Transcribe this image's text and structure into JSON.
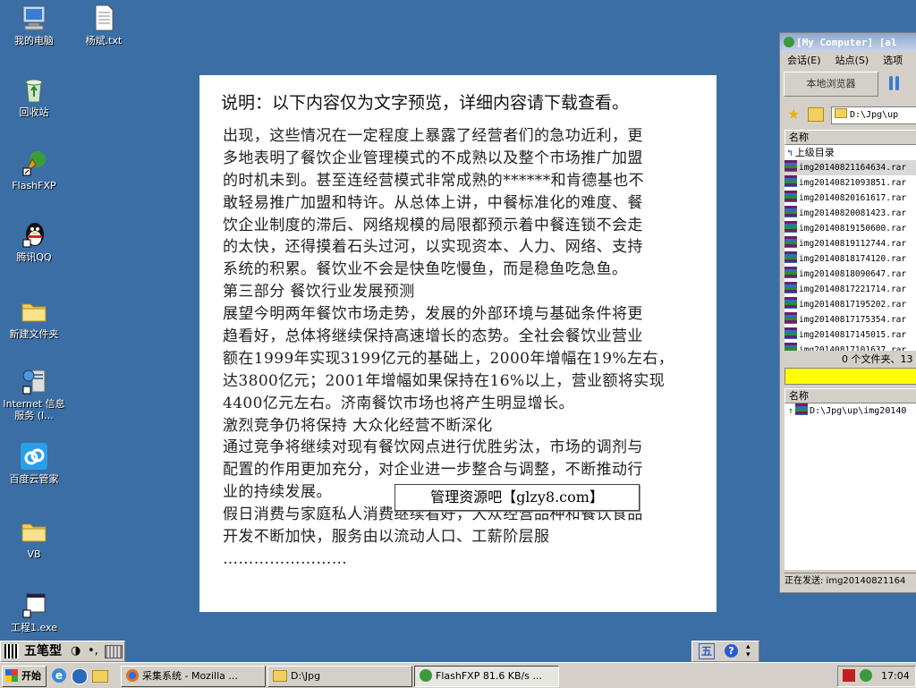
{
  "desktop": {
    "icons": [
      {
        "label": "我的电脑"
      },
      {
        "label": "杨斌.txt"
      },
      {
        "label": "回收站"
      },
      {
        "label": "FlashFXP"
      },
      {
        "label": "腾讯QQ"
      },
      {
        "label": "新建文件夹"
      },
      {
        "label": "Internet 信息服务 (I..."
      },
      {
        "label": "百度云管家"
      },
      {
        "label": "VB"
      },
      {
        "label": "工程1.exe"
      }
    ]
  },
  "document": {
    "title": "说明：以下内容仅为文字预览，详细内容请下载查看。",
    "lines": [
      "出现，这些情况在一定程度上暴露了经营者们的急功近利，更",
      "多地表明了餐饮企业管理模式的不成熟以及整个市场推广加盟",
      "的时机未到。甚至连经营模式非常成熟的******和肯德基也不",
      "敢轻易推广加盟和特许。从总体上讲，中餐标准化的难度、餐",
      "饮企业制度的滞后、网络规模的局限都预示着中餐连锁不会走",
      "的太快，还得摸着石头过河，以实现资本、人力、网络、支持",
      "系统的积累。餐饮业不会是快鱼吃慢鱼，而是稳鱼吃急鱼。",
      "第三部分 餐饮行业发展预测",
      "展望今明两年餐饮市场走势，发展的外部环境与基础条件将更",
      "趋看好，总体将继续保持高速增长的态势。全社会餐饮业营业",
      "额在1999年实现3199亿元的基础上，2000年增幅在19%左右，",
      "达3800亿元；2001年增幅如果保持在16%以上，营业额将实现",
      "4400亿元左右。济南餐饮市场也将产生明显增长。",
      "激烈竞争仍将保持 大众化经营不断深化",
      "通过竞争将继续对现有餐饮网点进行优胜劣汰，市场的调剂与",
      "配置的作用更加充分，对企业进一步整合与调整，不断推动行",
      "业的持续发展。",
      "假日消费与家庭私人消费继续看好，大众经营品种和餐饮食品",
      "开发不断加快，服务由以流动人口、工薪阶层服",
      "……………………"
    ],
    "watermark": "管理资源吧【glzy8.com】"
  },
  "flashfxp": {
    "title": "[My Computer]  [al",
    "menu": [
      "会话(E)",
      "站点(S)",
      "选项"
    ],
    "local_browser": "本地浏览器",
    "path": "D:\\Jpg\\up",
    "list_header": "名称",
    "parent_dir": "上级目录",
    "files": [
      "img20140821164634.rar",
      "img20140821093851.rar",
      "img20140820161617.rar",
      "img20140820081423.rar",
      "img20140819150600.rar",
      "img20140819112744.rar",
      "img20140818174120.rar",
      "img20140818090647.rar",
      "img20140817221714.rar",
      "img20140817195202.rar",
      "img20140817175354.rar",
      "img20140817145015.rar",
      "img20140817101637.rar"
    ],
    "status_text": "0 个文件夹、13",
    "queue_header": "名称",
    "queue_item": "D:\\Jpg\\up\\img20140",
    "sending": "正在发送: img20140821164"
  },
  "ime": {
    "label": "五笔型"
  },
  "taskbar": {
    "start": "开始",
    "tasks": [
      {
        "label": "采集系统 - Mozilla ..."
      },
      {
        "label": "D:\\Jpg"
      },
      {
        "label": "FlashFXP 81.6 KB/s ..."
      }
    ],
    "tray_lang": "五",
    "clock": "17:04"
  }
}
